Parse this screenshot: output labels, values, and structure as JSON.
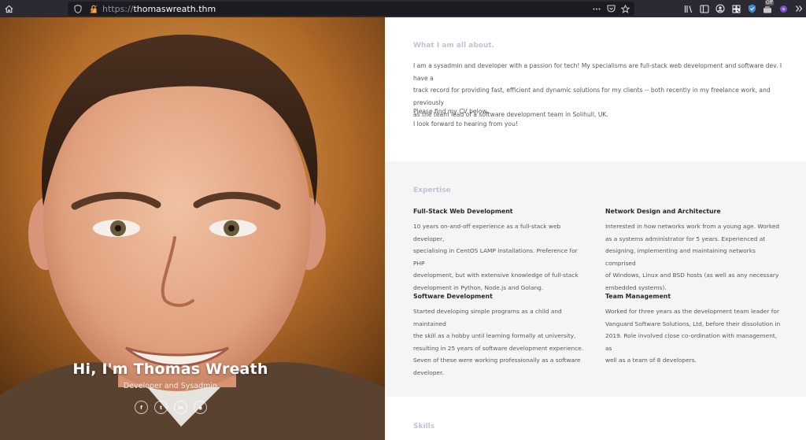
{
  "browser": {
    "url_scheme": "https://",
    "url_host": "thomaswreath.thm",
    "addon_badge": "Off",
    "icons": [
      "home-icon",
      "shield-icon",
      "lock-icon",
      "more-icon",
      "pocket-icon",
      "bookmark-star-icon",
      "library-icon",
      "sidebar-icon",
      "account-icon",
      "qr-icon",
      "extension-icon",
      "addon-icon",
      "extension-purple-icon",
      "overflow-icon"
    ]
  },
  "hero": {
    "name": "Hi, I'm Thomas Wreath",
    "role": "Developer and Sysadmin",
    "socials": [
      {
        "icon": "facebook-icon",
        "glyph": "f"
      },
      {
        "icon": "twitter-icon",
        "glyph": "t"
      },
      {
        "icon": "linkedin-icon",
        "glyph": "in"
      },
      {
        "icon": "github-icon",
        "glyph": "◉"
      }
    ]
  },
  "about": {
    "title": "What I am all about.",
    "lines": [
      "I am a sysadmin and developer with a passion for tech! My specialisms are full-stack web development and software dev. I have a",
      "track record for providing fast, efficient and dynamic solutions for my clients -- both recently in my freelance work, and previously",
      "as the team lead of a software development team in Solihull, UK."
    ],
    "cv_line": "Please find my CV below.",
    "closing_line": "I look forward to hearing from you!"
  },
  "expertise": {
    "title": "Expertise",
    "items": [
      {
        "heading": "Full-Stack Web Development",
        "lines": [
          "10 years on-and-off experience as a full-stack web developer,",
          "specialising in CentOS LAMP installations. Preference for PHP",
          "development, but with extensive knowledge of full-stack",
          "development in Python, Node.js and Golang."
        ]
      },
      {
        "heading": "Network Design and Architecture",
        "lines": [
          "Interested in how networks work from a young age. Worked",
          "as a systems administrator for 5 years. Experienced at",
          "designing, implementing and maintaining networks comprised",
          "of Windows, Linux and BSD hosts (as well as any necessary",
          "embedded systems)."
        ]
      },
      {
        "heading": "Software Development",
        "lines": [
          "Started developing simple programs as a child and maintained",
          "the skill as a hobby until learning formally at university,",
          "resulting in 25 years of software development experience.",
          "Seven of these were working professionally as a software",
          "developer."
        ]
      },
      {
        "heading": "Team Management",
        "lines": [
          "Worked for three years as the development team leader for",
          "Vanguard Software Solutions, Ltd, before their dissolution in",
          "2019. Role involved close co-ordination with management, as",
          "well as a team of 8 developers."
        ]
      }
    ]
  },
  "skills": {
    "title": "Skills"
  }
}
